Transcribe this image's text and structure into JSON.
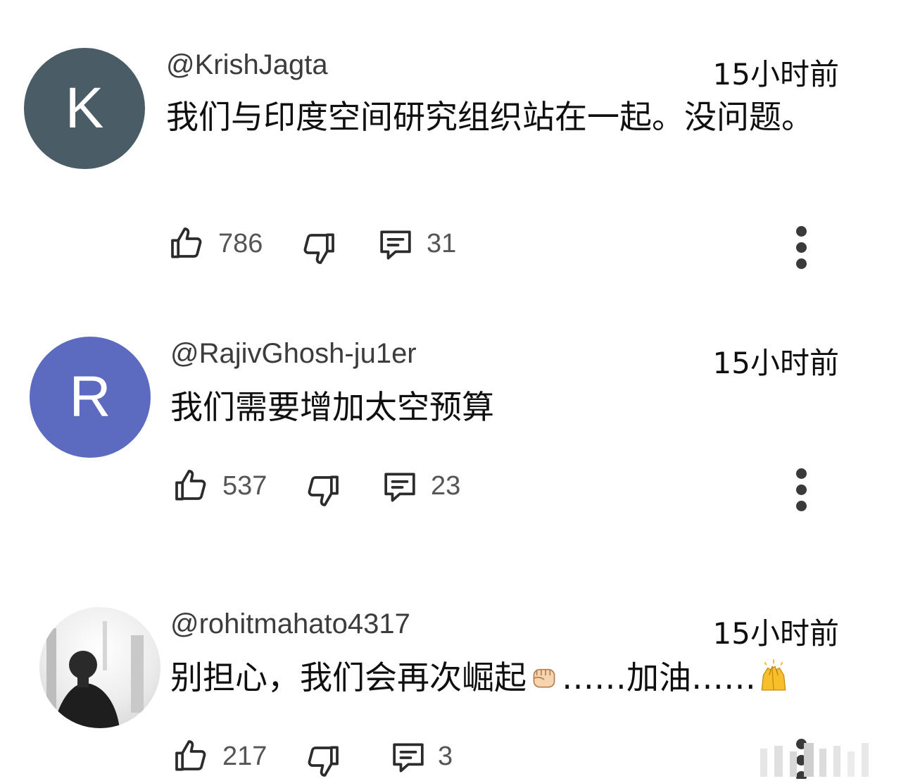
{
  "comments": [
    {
      "avatar_letter": "K",
      "avatar_color": "#4a5c66",
      "handle": "@KrishJagta",
      "time": "15小时前",
      "text": "我们与印度空间研究组织站在一起。没问题。",
      "likes": "786",
      "replies": "31"
    },
    {
      "avatar_letter": "R",
      "avatar_color": "#5c6bc0",
      "handle": "@RajivGhosh-ju1er",
      "time": "15小时前",
      "text": "我们需要增加太空预算",
      "likes": "537",
      "replies": "23"
    },
    {
      "avatar_letter": "",
      "handle": "@rohitmahato4317",
      "time": "15小时前",
      "text_part1": "别担心，我们会再次崛起",
      "text_part2": "……加油……",
      "likes": "217",
      "replies": "3"
    }
  ],
  "icons": {
    "like": "thumb-up-icon",
    "dislike": "thumb-down-icon",
    "reply": "comment-icon",
    "more": "more-vert-icon"
  }
}
